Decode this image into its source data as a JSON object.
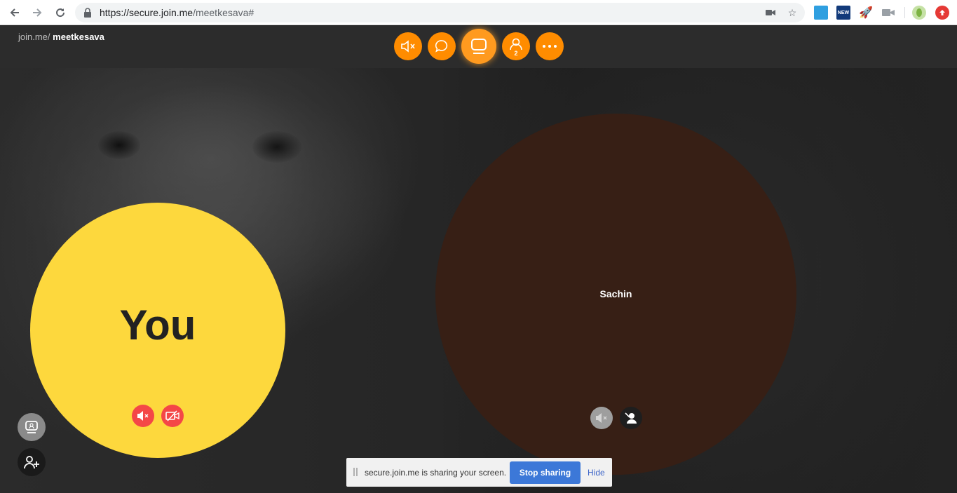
{
  "browser": {
    "url_main": "https://secure.join.me",
    "url_rest": "/meetkesava#"
  },
  "brand": {
    "prefix": "join.me/",
    "meeting": "meetkesava"
  },
  "toolbar": {
    "buttons": [
      {
        "icon": "speaker-muted-icon"
      },
      {
        "icon": "chat-icon"
      },
      {
        "icon": "screen-share-icon",
        "active": true
      },
      {
        "icon": "participants-icon",
        "badge": "2"
      },
      {
        "icon": "more-icon"
      }
    ]
  },
  "participants": {
    "you": {
      "label": "You"
    },
    "sachin": {
      "label": "Sachin"
    }
  },
  "share_bar": {
    "message": "secure.join.me is sharing your screen.",
    "stop_label": "Stop sharing",
    "hide_label": "Hide"
  },
  "colors": {
    "accent": "#ff8c00",
    "you_circle": "#fdd83d",
    "sachin_circle": "#371f15",
    "mute_red": "#f44747",
    "stop_blue": "#3c78d8"
  }
}
